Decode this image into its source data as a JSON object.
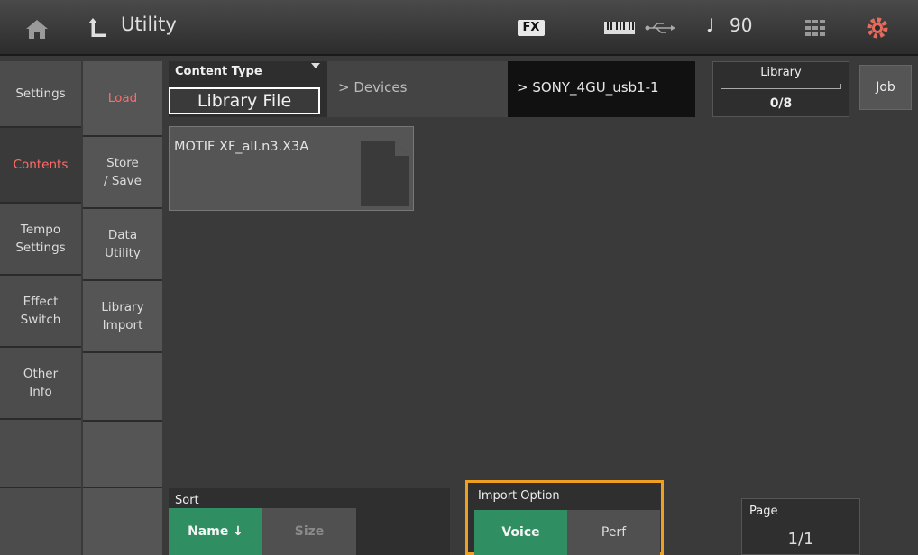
{
  "header": {
    "title": "Utility",
    "fx_label": "FX",
    "tempo_note": "♩",
    "tempo_value": "90",
    "icons": [
      "home-icon",
      "back-arrow-icon",
      "keyboard-icon",
      "usb-icon",
      "grid-icon",
      "gear-icon"
    ]
  },
  "left_tabs": [
    {
      "label": "Settings"
    },
    {
      "label": "Contents"
    },
    {
      "label": "Tempo\nSettings"
    },
    {
      "label": "Effect\nSwitch"
    },
    {
      "label": "Other\nInfo"
    }
  ],
  "sub_tabs": [
    {
      "label": "Load"
    },
    {
      "label": "Store\n/ Save"
    },
    {
      "label": "Data\nUtility"
    },
    {
      "label": "Library\nImport"
    }
  ],
  "content_type": {
    "label": "Content Type",
    "value": "Library File"
  },
  "path": {
    "devices": "> Devices",
    "current": "> SONY_4GU_usb1-1"
  },
  "library": {
    "label": "Library",
    "count": "0/8",
    "fraction": 0
  },
  "job_label": "Job",
  "files": [
    {
      "name": "MOTIF XF_all.n3.X3A"
    }
  ],
  "sort": {
    "label": "Sort",
    "options": [
      "Name ↓",
      "Size"
    ],
    "selected": "Name ↓"
  },
  "import_option": {
    "label": "Import Option",
    "options": [
      "Voice",
      "Perf"
    ],
    "selected": "Voice"
  },
  "page": {
    "label": "Page",
    "value": "1/1"
  },
  "colors": {
    "accent_red": "#ff6b6b",
    "selected_green": "#2f8f62",
    "focus_orange": "#f0a020"
  }
}
